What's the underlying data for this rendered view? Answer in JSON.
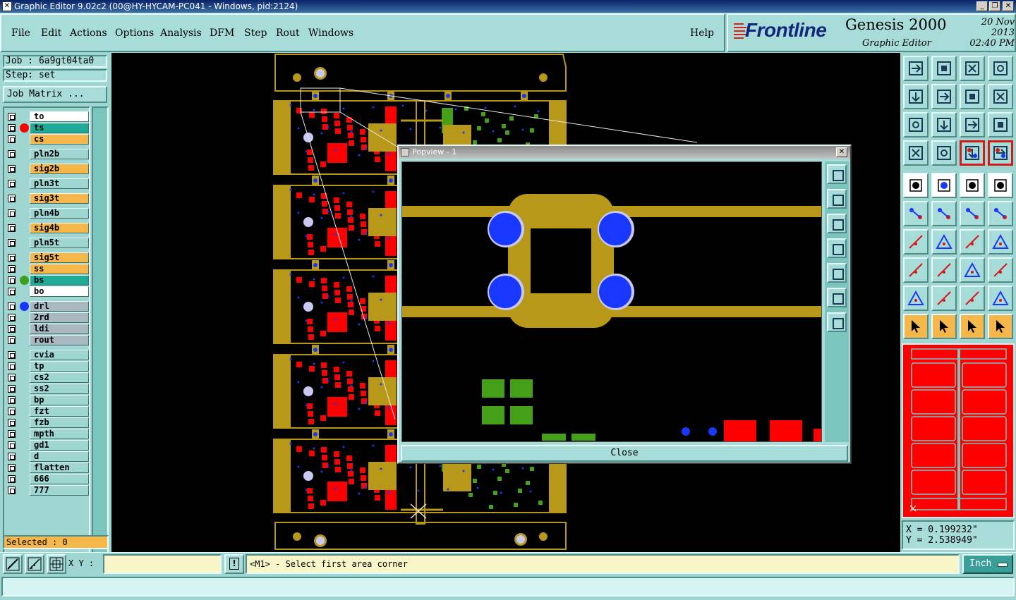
{
  "window": {
    "title": "Graphic Editor 9.02c2 (00@HY-HYCAM-PC041 - Windows, pid:2124)",
    "controls": [
      "minimize-icon",
      "maximize-icon",
      "close-icon"
    ]
  },
  "menu": {
    "items": [
      {
        "label": "File"
      },
      {
        "label": "Edit"
      },
      {
        "label": "Actions"
      },
      {
        "label": "Options"
      },
      {
        "label": "Analysis"
      },
      {
        "label": "DFM"
      },
      {
        "label": "Step"
      },
      {
        "label": "Rout"
      },
      {
        "label": "Windows"
      }
    ],
    "help": "Help"
  },
  "brand": {
    "logo_text": "Frontline",
    "product": "Genesis 2000",
    "subtitle": "Graphic Editor",
    "date": "20 Nov 2013",
    "time": "02:40 PM"
  },
  "job": {
    "job_label": "Job : 6a9gt04ta0",
    "step_label": "Step: set",
    "matrix_button": "Job Matrix ..."
  },
  "layers": [
    {
      "name": "to",
      "color": "#ffffff",
      "dot": ""
    },
    {
      "name": "ts",
      "color": "#1faa98",
      "dot": "#ff0000",
      "active": true
    },
    {
      "name": "cs",
      "color": "#f5b64a",
      "dot": ""
    },
    {
      "name": "pln2b",
      "color": "#9fd6d2",
      "dot": ""
    },
    {
      "name": "sig2b",
      "color": "#f5b64a",
      "dot": ""
    },
    {
      "name": "pln3t",
      "color": "#9fd6d2",
      "dot": ""
    },
    {
      "name": "sig3t",
      "color": "#f5b64a",
      "dot": ""
    },
    {
      "name": "pln4b",
      "color": "#9fd6d2",
      "dot": ""
    },
    {
      "name": "sig4b",
      "color": "#f5b64a",
      "dot": ""
    },
    {
      "name": "pln5t",
      "color": "#9fd6d2",
      "dot": ""
    },
    {
      "name": "sig5t",
      "color": "#f5b64a",
      "dot": ""
    },
    {
      "name": "ss",
      "color": "#f5b64a",
      "dot": ""
    },
    {
      "name": "bs",
      "color": "#1faa98",
      "dot": "#3ca01e"
    },
    {
      "name": "bo",
      "color": "#ffffff",
      "dot": ""
    },
    {
      "name": "drl",
      "color": "#a8b8c0",
      "dot": "#1838ff"
    },
    {
      "name": "2rd",
      "color": "#a8b8c0",
      "dot": ""
    },
    {
      "name": "ldi",
      "color": "#a8b8c0",
      "dot": ""
    },
    {
      "name": "rout",
      "color": "#a8b8c0",
      "dot": ""
    },
    {
      "name": "cvia",
      "color": "#9fd6d2",
      "dot": ""
    },
    {
      "name": "tp",
      "color": "#9fd6d2",
      "dot": ""
    },
    {
      "name": "cs2",
      "color": "#9fd6d2",
      "dot": ""
    },
    {
      "name": "ss2",
      "color": "#9fd6d2",
      "dot": ""
    },
    {
      "name": "bp",
      "color": "#9fd6d2",
      "dot": ""
    },
    {
      "name": "fzt",
      "color": "#9fd6d2",
      "dot": ""
    },
    {
      "name": "fzb",
      "color": "#9fd6d2",
      "dot": ""
    },
    {
      "name": "mpth",
      "color": "#9fd6d2",
      "dot": ""
    },
    {
      "name": "gd1",
      "color": "#9fd6d2",
      "dot": ""
    },
    {
      "name": "d",
      "color": "#9fd6d2",
      "dot": ""
    },
    {
      "name": "flatten",
      "color": "#9fd6d2",
      "dot": ""
    },
    {
      "name": "666",
      "color": "#9fd6d2",
      "dot": ""
    },
    {
      "name": "777",
      "color": "#9fd6d2",
      "dot": ""
    }
  ],
  "selected": "Selected : 0",
  "popview": {
    "title": "Popview - 1",
    "close_button": "Close"
  },
  "coords": {
    "x": "X = 0.199232\"",
    "y": "Y = 2.538949\""
  },
  "bottom": {
    "xy_label": "X Y :",
    "xy_value": "",
    "warn_glyph": "!",
    "prompt": "<M1> - Select first area corner",
    "units": "Inch"
  },
  "colors": {
    "copper": "#b89818",
    "pad_red": "#ff0000",
    "pad_green": "#44a018",
    "via_blue": "#1838ff",
    "via_ring": "#c8c8f0",
    "panel_teal": "#9fd6d2"
  }
}
